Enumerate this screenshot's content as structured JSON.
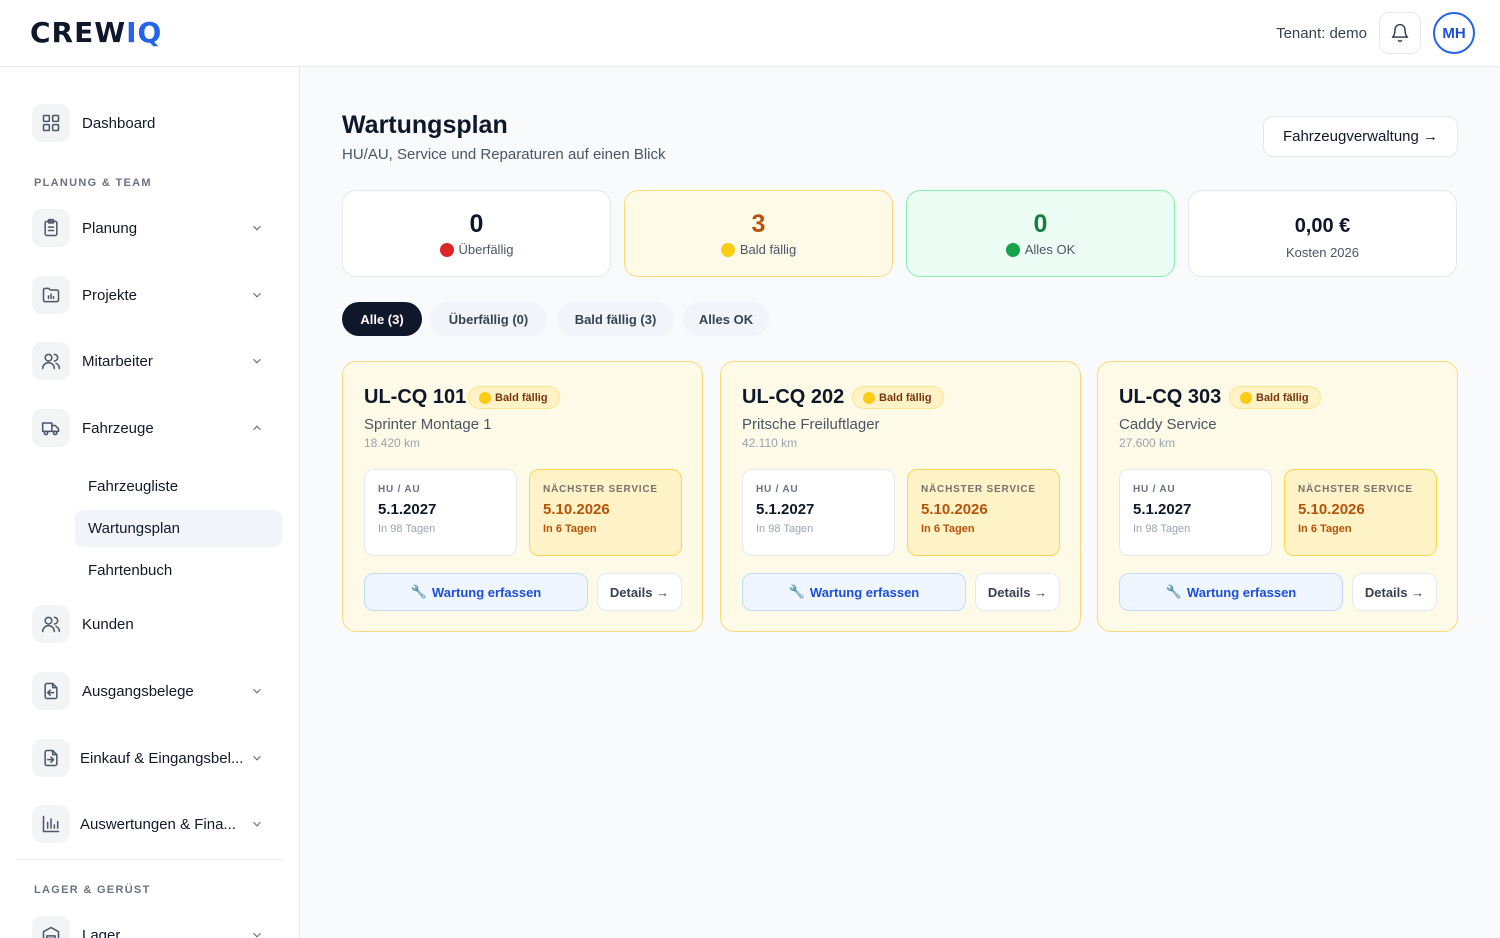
{
  "header": {
    "logo_main": "CREW",
    "logo_accent": "IQ",
    "tenant": "Tenant: demo",
    "avatar_initials": "MH"
  },
  "sidebar": {
    "dashboard": "Dashboard",
    "section_planning": "PLANUNG & TEAM",
    "planung": "Planung",
    "projekte": "Projekte",
    "mitarbeiter": "Mitarbeiter",
    "fahrzeuge": "Fahrzeuge",
    "fahrzeuge_sub": [
      "Fahrzeugliste",
      "Wartungsplan",
      "Fahrtenbuch"
    ],
    "kunden": "Kunden",
    "ausgangsbelege": "Ausgangsbelege",
    "einkauf": "Einkauf & Eingangsbel...",
    "auswertungen": "Auswertungen & Fina...",
    "section_lager": "LAGER & GERÜST",
    "lager": "Lager"
  },
  "page": {
    "title": "Wartungsplan",
    "subtitle": "HU/AU, Service und Reparaturen auf einen Blick",
    "fleet_button": "Fahrzeugverwaltung →"
  },
  "stats": [
    {
      "value": "0",
      "label": "Überfällig",
      "color": "#dc2626"
    },
    {
      "value": "3",
      "label": "Bald fällig",
      "color": "#facc15"
    },
    {
      "value": "0",
      "label": "Alles OK",
      "color": "#16a34a"
    },
    {
      "value": "0,00 €",
      "label": "Kosten 2026"
    }
  ],
  "filters": [
    "Alle (3)",
    "Überfällig (0)",
    "Bald fällig (3)",
    "Alles OK"
  ],
  "vehicles": [
    {
      "plate": "UL-CQ 101",
      "badge": "Bald fällig",
      "name": "Sprinter Montage 1",
      "km": "18.420 km",
      "hu_label": "HU / AU",
      "hu_date": "5.1.2027",
      "hu_rel": "In 98 Tagen",
      "svc_label": "NÄCHSTER SERVICE",
      "svc_date": "5.10.2026",
      "svc_rel": "In 6 Tagen",
      "wartung": "Wartung erfassen",
      "details": "Details →"
    },
    {
      "plate": "UL-CQ 202",
      "badge": "Bald fällig",
      "name": "Pritsche Freiluftlager",
      "km": "42.110 km",
      "hu_label": "HU / AU",
      "hu_date": "5.1.2027",
      "hu_rel": "In 98 Tagen",
      "svc_label": "NÄCHSTER SERVICE",
      "svc_date": "5.10.2026",
      "svc_rel": "In 6 Tagen",
      "wartung": "Wartung erfassen",
      "details": "Details →"
    },
    {
      "plate": "UL-CQ 303",
      "badge": "Bald fällig",
      "name": "Caddy Service",
      "km": "27.600 km",
      "hu_label": "HU / AU",
      "hu_date": "5.1.2027",
      "hu_rel": "In 98 Tagen",
      "svc_label": "NÄCHSTER SERVICE",
      "svc_date": "5.10.2026",
      "svc_rel": "In 6 Tagen",
      "wartung": "Wartung erfassen",
      "details": "Details →"
    }
  ],
  "colors": {
    "accent": "#2563eb",
    "warning_bg": "#fefae8",
    "warning_border": "#fcd97a",
    "dark": "#0f172a"
  }
}
